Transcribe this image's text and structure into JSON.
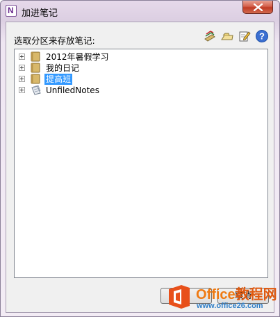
{
  "window": {
    "title": "加进笔记",
    "app_icon_letter": "N"
  },
  "dialog": {
    "prompt": "选取分区来存放笔记:"
  },
  "toolbar": {
    "icons": [
      "new-section-icon",
      "new-notebook-icon",
      "edit-icon",
      "help-icon"
    ],
    "help_glyph": "?"
  },
  "tree": {
    "items": [
      {
        "label": "2012年暑假学习",
        "icon": "notebook-icon",
        "selected": false
      },
      {
        "label": "我的日记",
        "icon": "notebook-icon",
        "selected": false
      },
      {
        "label": "提高班",
        "icon": "notebook-icon",
        "selected": true
      },
      {
        "label": "UnfiledNotes",
        "icon": "unfiled-notes-icon",
        "selected": false
      }
    ]
  },
  "buttons": {
    "cancel_label": "取消"
  },
  "watermark": {
    "title_en": "Office",
    "title_cn": "教程网",
    "url": "www.office26.com"
  },
  "colors": {
    "selection": "#3399ff",
    "notebook_tan": "#d8b86a",
    "watermark_orange": "#ef7a13",
    "watermark_blue": "#2f7fc8",
    "help_blue": "#3b6fd1"
  }
}
